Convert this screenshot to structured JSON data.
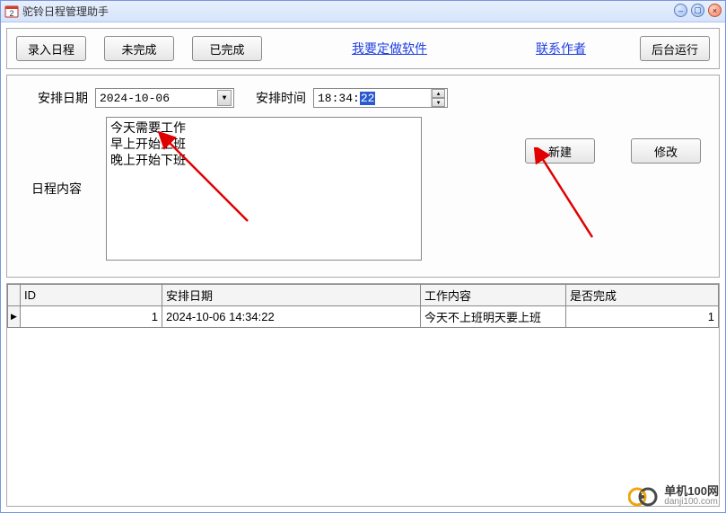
{
  "window": {
    "title": "驼铃日程管理助手"
  },
  "toolbar": {
    "enter_schedule": "录入日程",
    "incomplete": "未完成",
    "complete": "已完成",
    "custom_software": "我要定做软件",
    "contact_author": "联系作者",
    "run_background": "后台运行"
  },
  "form": {
    "date_label": "安排日期",
    "date_value": "2024-10-06",
    "time_label": "安排时间",
    "time_prefix": "18:34:",
    "time_selected": "22",
    "content_label": "日程内容",
    "content_value": "今天需要工作\n早上开始上班\n晚上开始下班",
    "new_btn": "新建",
    "edit_btn": "修改"
  },
  "grid": {
    "headers": {
      "id": "ID",
      "date": "安排日期",
      "content": "工作内容",
      "done": "是否完成"
    },
    "row_indicator": "▶",
    "rows": [
      {
        "id": "1",
        "date": "2024-10-06 14:34:22",
        "content": "今天不上班明天要上班",
        "done": "1"
      }
    ]
  },
  "watermark": {
    "cn": "单机100网",
    "en": "danji100.com"
  }
}
